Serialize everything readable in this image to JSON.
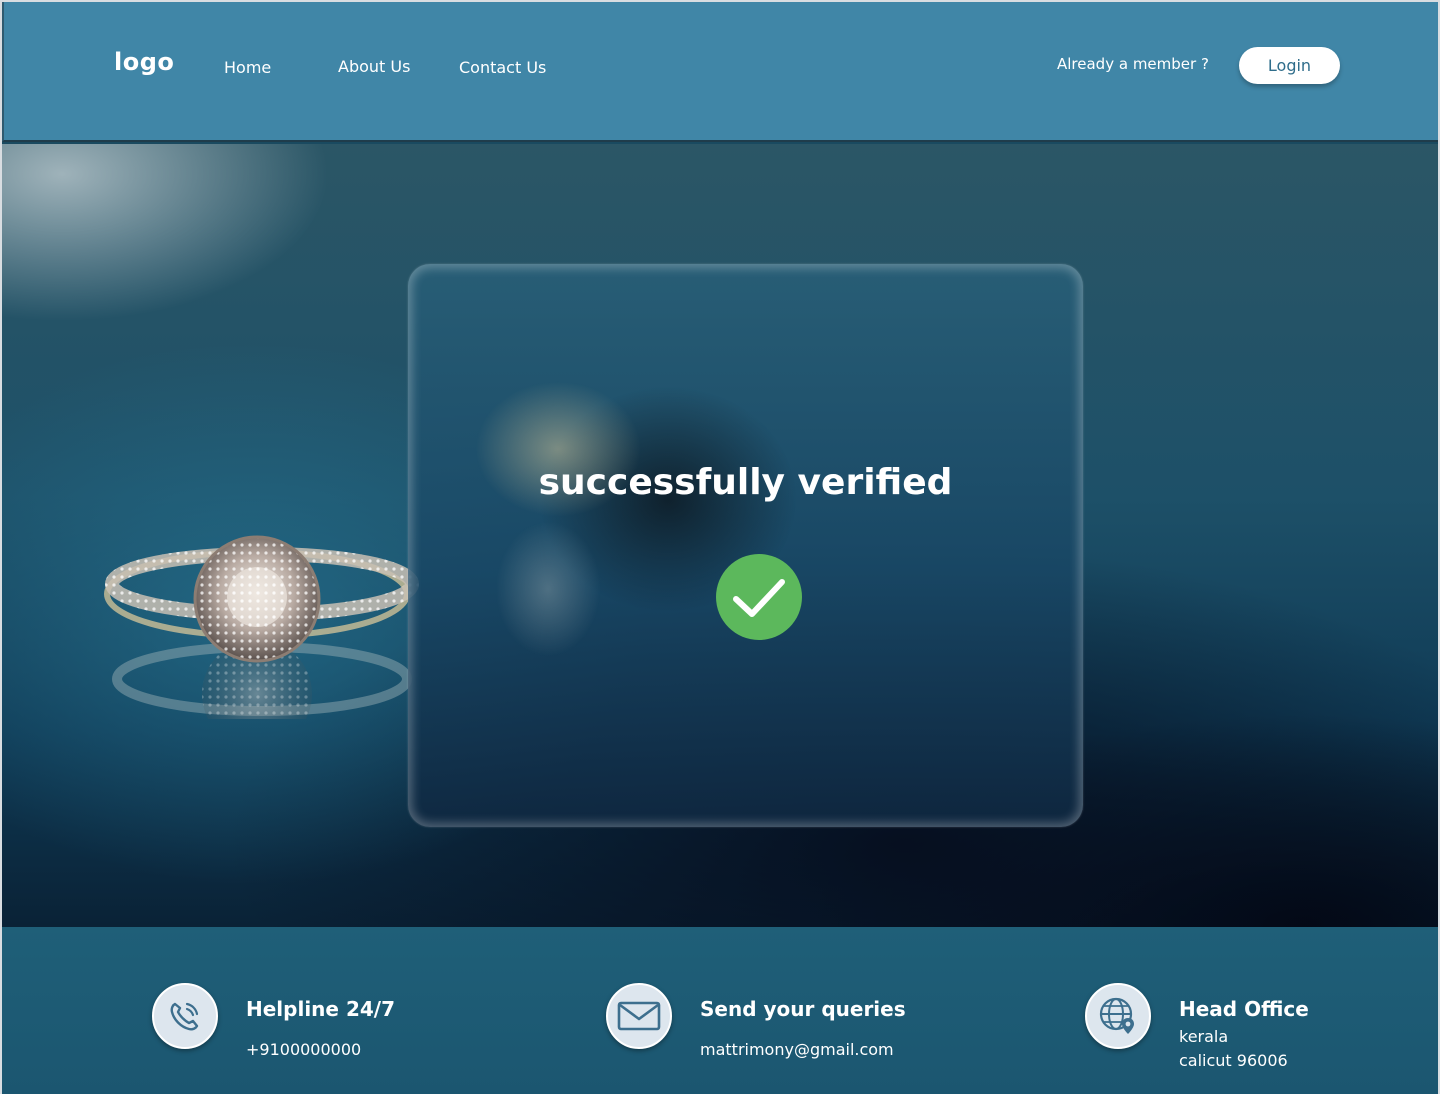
{
  "header": {
    "logo": "logo",
    "nav": [
      "Home",
      "About Us",
      "Contact Us"
    ],
    "member_prompt": "Already a member ?",
    "login_label": "Login"
  },
  "verification": {
    "message": "successfully verified",
    "status_icon": "check-circle-icon",
    "status_color": "#5cb85c"
  },
  "footer": {
    "helpline": {
      "icon": "phone-icon",
      "title": "Helpline 24/7",
      "value": "+9100000000"
    },
    "queries": {
      "icon": "mail-icon",
      "title": "Send your queries",
      "value": "mattrimony@gmail.com"
    },
    "office": {
      "icon": "globe-location-icon",
      "title": "Head Office",
      "line1": "kerala",
      "line2": "calicut 96006"
    }
  },
  "colors": {
    "header_bg": "#4086a7",
    "footer_bg": "#1f5f78",
    "login_text": "#2f6d8b",
    "icon_stroke": "#3d6f8e"
  }
}
